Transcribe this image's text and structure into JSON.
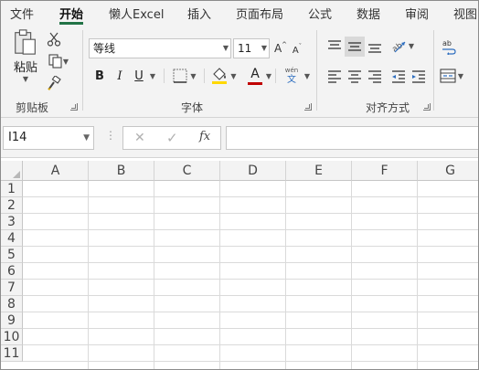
{
  "tabs": [
    {
      "label": "文件"
    },
    {
      "label": "开始"
    },
    {
      "label": "懒人Excel"
    },
    {
      "label": "插入"
    },
    {
      "label": "页面布局"
    },
    {
      "label": "公式"
    },
    {
      "label": "数据"
    },
    {
      "label": "审阅"
    },
    {
      "label": "视图"
    }
  ],
  "ribbon": {
    "clipboard": {
      "label": "剪贴板",
      "paste_label": "粘贴"
    },
    "font": {
      "label": "字体",
      "font_name": "等线",
      "font_size": "11",
      "bold": "B",
      "italic": "I",
      "underline": "U",
      "font_color_glyph": "A",
      "wen_top": "wén",
      "wen_bottom": "文",
      "grow_glyph": "A",
      "shrink_glyph": "A",
      "font_color": "#c00000",
      "fill_color": "#ffd800"
    },
    "alignment": {
      "label": "对齐方式"
    }
  },
  "formula_bar": {
    "name_box": "I14",
    "cancel_glyph": "✕",
    "enter_glyph": "✓",
    "fx_glyph": "fx",
    "formula": ""
  },
  "sheet": {
    "columns": [
      "A",
      "B",
      "C",
      "D",
      "E",
      "F",
      "G"
    ],
    "rows": [
      "1",
      "2",
      "3",
      "4",
      "5",
      "6",
      "7",
      "8",
      "9",
      "10",
      "11"
    ]
  },
  "colors": {
    "accent": "#217346",
    "ribbon_bg": "#f3f3f3",
    "grid_line": "#dadada"
  }
}
